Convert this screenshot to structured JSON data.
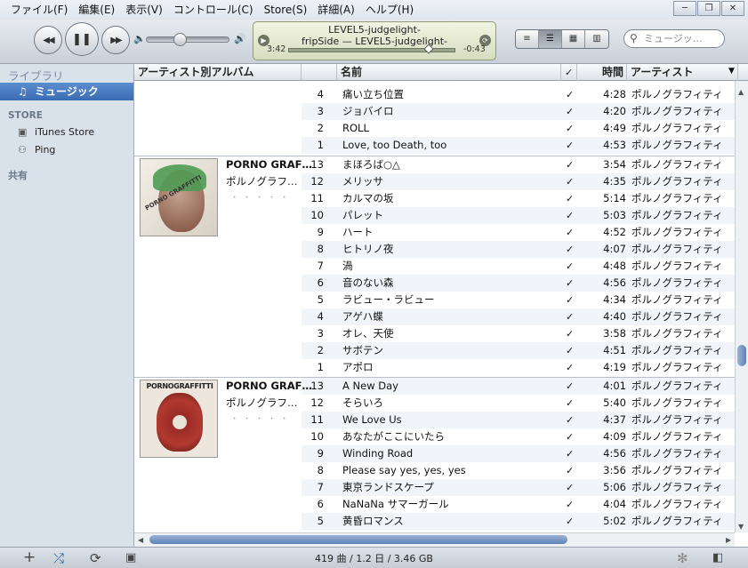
{
  "menu": [
    "ファイル(F)",
    "編集(E)",
    "表示(V)",
    "コントロール(C)",
    "Store(S)",
    "詳細(A)",
    "ヘルプ(H)"
  ],
  "window_buttons": [
    "─",
    "❐",
    "✕"
  ],
  "player": {
    "prev": "◀◀",
    "pause": "❚❚",
    "next": "▶▶",
    "vol_low": "🔈",
    "vol_high": "🔊",
    "volume_level": 0.4
  },
  "now_playing": {
    "title": "LEVEL5-judgelight-",
    "subtitle": "fripSide — LEVEL5-judgelight-",
    "elapsed": "3:42",
    "remaining": "-0:43",
    "progress": 0.84
  },
  "view_buttons": [
    "≡",
    "☰",
    "▦",
    "▥"
  ],
  "search": {
    "placeholder": "ミュージッ…",
    "icon": "search-icon"
  },
  "sidebar": {
    "library_header": "ライブラリ",
    "music": "ミュージック",
    "store_header": "STORE",
    "itunes_store": "iTunes Store",
    "ping": "Ping",
    "shared_header": "共有"
  },
  "columns": {
    "album_by_artist": "アーティスト別アルバム",
    "name": "名前",
    "check": "✓",
    "time": "時間",
    "artist": "アーティスト"
  },
  "albums": [
    {
      "artist_name": "PORNO GRAF…",
      "artist_kana": "ポルノグラフ…",
      "stars": "・・・・・",
      "cover_text": "PORNO GRAFFITTI"
    },
    {
      "artist_name": "PORNO GRAF…",
      "artist_kana": "ポルノグラフ…",
      "stars": "・・・・・",
      "cover_text": "PORNOGRAFFITTI"
    }
  ],
  "tracks": [
    {
      "num": "4",
      "title": "痛い立ち位置",
      "check": "✓",
      "time": "4:28",
      "artist": "ポルノグラフィティ"
    },
    {
      "num": "3",
      "title": "ジョバイロ",
      "check": "✓",
      "time": "4:20",
      "artist": "ポルノグラフィティ"
    },
    {
      "num": "2",
      "title": "ROLL",
      "check": "✓",
      "time": "4:49",
      "artist": "ポルノグラフィティ"
    },
    {
      "num": "1",
      "title": "Love, too Death, too",
      "check": "✓",
      "time": "4:53",
      "artist": "ポルノグラフィティ"
    },
    {
      "num": "13",
      "title": "まほろば○△",
      "check": "✓",
      "time": "3:54",
      "artist": "ポルノグラフィティ"
    },
    {
      "num": "12",
      "title": "メリッサ",
      "check": "✓",
      "time": "4:35",
      "artist": "ポルノグラフィティ"
    },
    {
      "num": "11",
      "title": "カルマの坂",
      "check": "✓",
      "time": "5:14",
      "artist": "ポルノグラフィティ"
    },
    {
      "num": "10",
      "title": "パレット",
      "check": "✓",
      "time": "5:03",
      "artist": "ポルノグラフィティ"
    },
    {
      "num": "9",
      "title": "ハート",
      "check": "✓",
      "time": "4:52",
      "artist": "ポルノグラフィティ"
    },
    {
      "num": "8",
      "title": "ヒトリノ夜",
      "check": "✓",
      "time": "4:07",
      "artist": "ポルノグラフィティ"
    },
    {
      "num": "7",
      "title": "渦",
      "check": "✓",
      "time": "4:48",
      "artist": "ポルノグラフィティ"
    },
    {
      "num": "6",
      "title": "音のない森",
      "check": "✓",
      "time": "4:56",
      "artist": "ポルノグラフィティ"
    },
    {
      "num": "5",
      "title": "ラビュー・ラビュー",
      "check": "✓",
      "time": "4:34",
      "artist": "ポルノグラフィティ"
    },
    {
      "num": "4",
      "title": "アゲハ蝶",
      "check": "✓",
      "time": "4:40",
      "artist": "ポルノグラフィティ"
    },
    {
      "num": "3",
      "title": "オレ、天使",
      "check": "✓",
      "time": "3:58",
      "artist": "ポルノグラフィティ"
    },
    {
      "num": "2",
      "title": "サボテン",
      "check": "✓",
      "time": "4:51",
      "artist": "ポルノグラフィティ"
    },
    {
      "num": "1",
      "title": "アポロ",
      "check": "✓",
      "time": "4:19",
      "artist": "ポルノグラフィティ"
    },
    {
      "num": "13",
      "title": "A New Day",
      "check": "✓",
      "time": "4:01",
      "artist": "ポルノグラフィティ"
    },
    {
      "num": "12",
      "title": "そらいろ",
      "check": "✓",
      "time": "5:40",
      "artist": "ポルノグラフィティ"
    },
    {
      "num": "11",
      "title": "We Love Us",
      "check": "✓",
      "time": "4:37",
      "artist": "ポルノグラフィティ"
    },
    {
      "num": "10",
      "title": "あなたがここにいたら",
      "check": "✓",
      "time": "4:09",
      "artist": "ポルノグラフィティ"
    },
    {
      "num": "9",
      "title": "Winding Road",
      "check": "✓",
      "time": "4:56",
      "artist": "ポルノグラフィティ"
    },
    {
      "num": "8",
      "title": "Please say yes, yes, yes",
      "check": "✓",
      "time": "3:56",
      "artist": "ポルノグラフィティ"
    },
    {
      "num": "7",
      "title": "東京ランドスケープ",
      "check": "✓",
      "time": "5:06",
      "artist": "ポルノグラフィティ"
    },
    {
      "num": "6",
      "title": "NaNaNa サマーガール",
      "check": "✓",
      "time": "4:04",
      "artist": "ポルノグラフィティ"
    },
    {
      "num": "5",
      "title": "黄昏ロマンス",
      "check": "✓",
      "time": "5:02",
      "artist": "ポルノグラフィティ"
    }
  ],
  "bottom": {
    "add": "+",
    "shuffle": "⤮",
    "repeat": "⟳",
    "artwork": "▣",
    "status": "419 曲 / 1.2 日 / 3.46 GB",
    "genius": "✻",
    "mini": "◧"
  }
}
